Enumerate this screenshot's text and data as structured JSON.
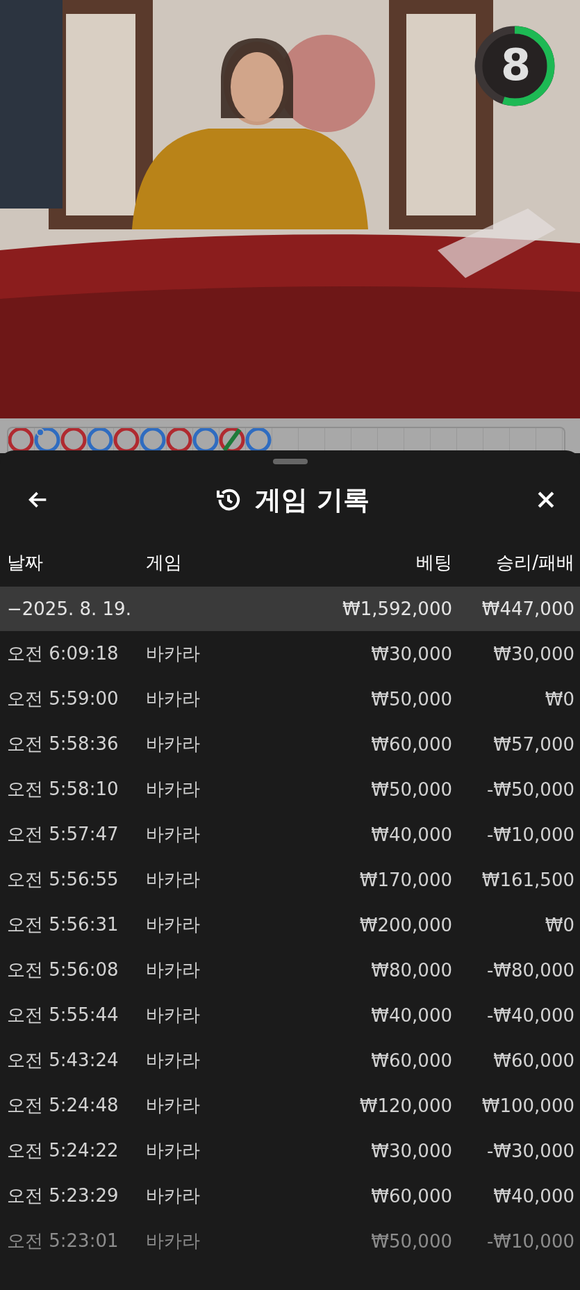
{
  "video": {
    "kind": "picture",
    "countdown": {
      "value": "8",
      "level": 0.55
    }
  },
  "road": [
    {
      "color": "#b02a30",
      "pair": false,
      "tie": false
    },
    {
      "color": "#2f6cc0",
      "pair": true,
      "tie": false
    },
    {
      "color": "#b02a30",
      "pair": false,
      "tie": false
    },
    {
      "color": "#2f6cc0",
      "pair": false,
      "tie": false
    },
    {
      "color": "#b02a30",
      "pair": false,
      "tie": false
    },
    {
      "color": "#2f6cc0",
      "pair": false,
      "tie": false
    },
    {
      "color": "#b02a30",
      "pair": false,
      "tie": false
    },
    {
      "color": "#2f6cc0",
      "pair": false,
      "tie": false
    },
    {
      "color": "#b02a30",
      "pair": false,
      "tie": true
    },
    {
      "color": "#2f6cc0",
      "pair": false,
      "tie": false
    }
  ],
  "sheet": {
    "title": "게임 기록"
  },
  "table": {
    "columns": [
      "날짜",
      "게임",
      "베팅",
      "승리/패배"
    ],
    "group": {
      "date": "−2025. 8. 19.",
      "bet": "₩1,592,000",
      "result": "₩447,000"
    },
    "rows": [
      {
        "time": "오전 6:09:18",
        "game": "바카라",
        "bet": "₩30,000",
        "result": "₩30,000"
      },
      {
        "time": "오전 5:59:00",
        "game": "바카라",
        "bet": "₩50,000",
        "result": "₩0"
      },
      {
        "time": "오전 5:58:36",
        "game": "바카라",
        "bet": "₩60,000",
        "result": "₩57,000"
      },
      {
        "time": "오전 5:58:10",
        "game": "바카라",
        "bet": "₩50,000",
        "result": "-₩50,000"
      },
      {
        "time": "오전 5:57:47",
        "game": "바카라",
        "bet": "₩40,000",
        "result": "-₩10,000"
      },
      {
        "time": "오전 5:56:55",
        "game": "바카라",
        "bet": "₩170,000",
        "result": "₩161,500"
      },
      {
        "time": "오전 5:56:31",
        "game": "바카라",
        "bet": "₩200,000",
        "result": "₩0"
      },
      {
        "time": "오전 5:56:08",
        "game": "바카라",
        "bet": "₩80,000",
        "result": "-₩80,000"
      },
      {
        "time": "오전 5:55:44",
        "game": "바카라",
        "bet": "₩40,000",
        "result": "-₩40,000"
      },
      {
        "time": "오전 5:43:24",
        "game": "바카라",
        "bet": "₩60,000",
        "result": "₩60,000"
      },
      {
        "time": "오전 5:24:48",
        "game": "바카라",
        "bet": "₩120,000",
        "result": "₩100,000"
      },
      {
        "time": "오전 5:24:22",
        "game": "바카라",
        "bet": "₩30,000",
        "result": "-₩30,000"
      },
      {
        "time": "오전 5:23:29",
        "game": "바카라",
        "bet": "₩60,000",
        "result": "₩40,000"
      },
      {
        "time": "오전 5:23:01",
        "game": "바카라",
        "bet": "₩50,000",
        "result": "-₩10,000",
        "faded": true
      }
    ]
  }
}
